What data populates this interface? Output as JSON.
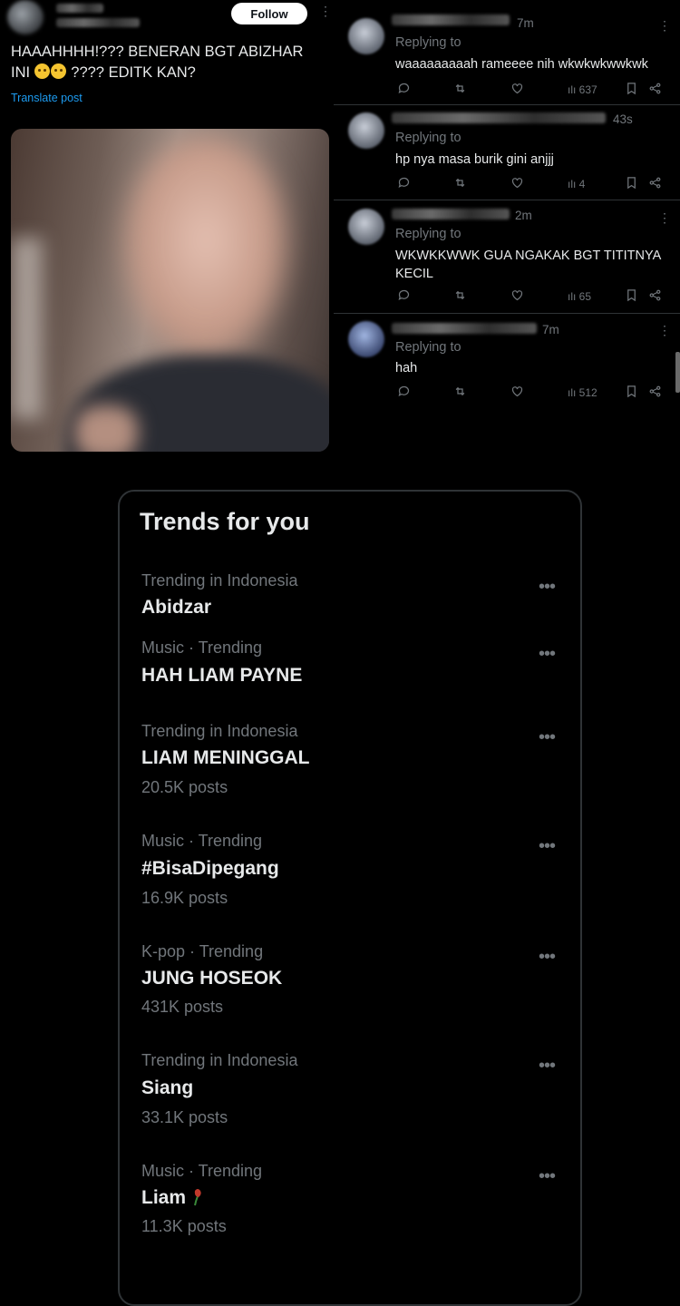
{
  "post": {
    "follow_label": "Follow",
    "text": "HAAAHHHH!??? BENERAN BGT ABIZHAR INI",
    "text_after_emoji": "???? EDITK KAN?",
    "translate_label": "Translate post"
  },
  "replies": [
    {
      "time": "7m",
      "replying_to": "Replying to",
      "text": "waaaaaaaaah rameeee nih wkwkwkwwkwk",
      "views": "637"
    },
    {
      "time": "43s",
      "replying_to": "Replying to",
      "text": "hp nya masa burik gini anjjj",
      "views": "4"
    },
    {
      "time": "2m",
      "replying_to": "Replying to",
      "text": "WKWKKWWK GUA NGAKAK BGT TITITNYA KECIL",
      "views": "65"
    },
    {
      "time": "7m",
      "replying_to": "Replying to",
      "text": "hah",
      "views": "512"
    }
  ],
  "trends": {
    "title": "Trends for you",
    "more_label": "•••",
    "items": [
      {
        "context": "Trending in Indonesia",
        "name": "Abidzar",
        "posts": ""
      },
      {
        "context": "Music · Trending",
        "name": "HAH LIAM PAYNE",
        "posts": ""
      },
      {
        "context": "Trending in Indonesia",
        "name": "LIAM MENINGGAL",
        "posts": "20.5K posts"
      },
      {
        "context": "Music · Trending",
        "name": "#BisaDipegang",
        "posts": "16.9K posts"
      },
      {
        "context": "K-pop · Trending",
        "name": "JUNG HOSEOK",
        "posts": "431K posts"
      },
      {
        "context": "Trending in Indonesia",
        "name": "Siang",
        "posts": "33.1K posts"
      },
      {
        "context": "Music · Trending",
        "name": "Liam",
        "posts": "11.3K posts"
      }
    ]
  }
}
